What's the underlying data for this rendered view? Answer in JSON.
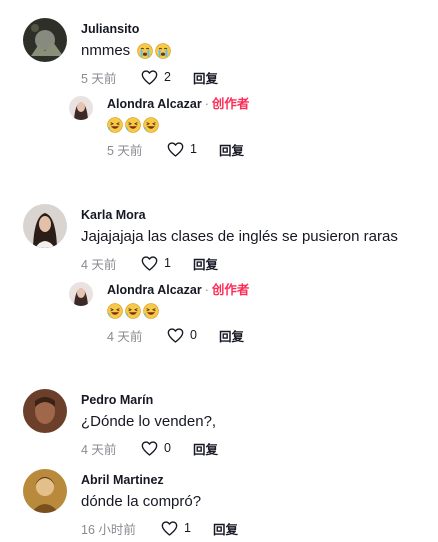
{
  "comments": [
    {
      "user": "Juliansito",
      "text": "nmmes",
      "emoji": "crying-face-emoji",
      "emoji_count": 2,
      "time": "5 天前",
      "likes": "2",
      "reply": "回复",
      "replies": [
        {
          "user": "Alondra Alcazar",
          "badge": "创作者",
          "emoji": "laughing-face-emoji",
          "emoji_count": 3,
          "time": "5 天前",
          "likes": "1",
          "reply": "回复"
        }
      ]
    },
    {
      "user": "Karla Mora",
      "text": "Jajajajaja las clases de inglés se pusieron raras",
      "time": "4 天前",
      "likes": "1",
      "reply": "回复",
      "replies": [
        {
          "user": "Alondra Alcazar",
          "badge": "创作者",
          "emoji": "laughing-face-emoji",
          "emoji_count": 3,
          "time": "4 天前",
          "likes": "0",
          "reply": "回复"
        }
      ]
    },
    {
      "user": "Pedro Marín",
      "text": "¿Dónde lo venden?,",
      "time": "4 天前",
      "likes": "0",
      "reply": "回复"
    },
    {
      "user": "Abril Martinez",
      "text": "dónde la compró?",
      "time": "16 小时前",
      "likes": "1",
      "reply": "回复"
    }
  ],
  "colors": {
    "creator_badge": "#fe2c55",
    "meta_gray": "#8a8b91",
    "text": "#161823"
  }
}
